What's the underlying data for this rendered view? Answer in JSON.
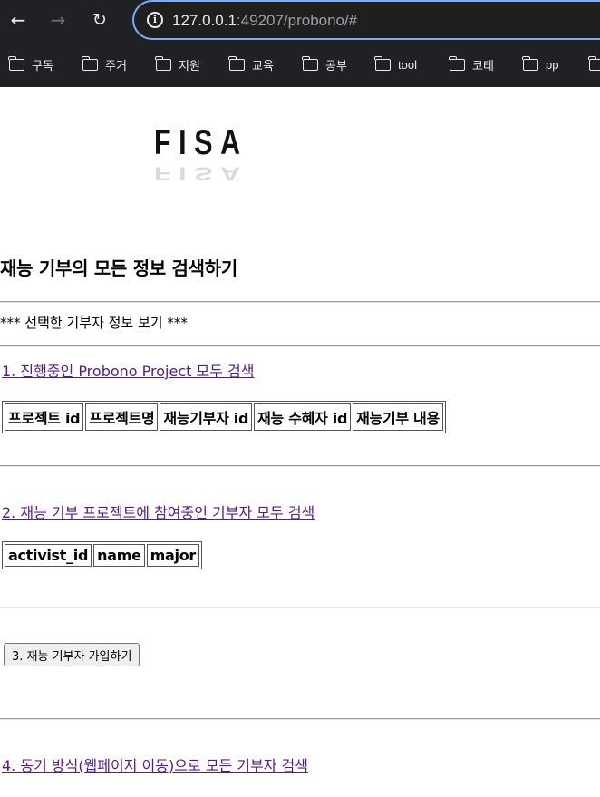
{
  "browser": {
    "url_host": "127.0.0.1",
    "url_rest": ":49207/probono/#",
    "bookmarks": [
      "구독",
      "주거",
      "지원",
      "교육",
      "공부",
      "tool",
      "코테",
      "pp"
    ]
  },
  "logo": {
    "text": "FISA"
  },
  "page": {
    "title": "재능 기부의 모든 정보 검색하기",
    "subtitle": "*** 선택한 기부자 정보 보기 ***"
  },
  "section1": {
    "link": "1. 진행중인 Probono Project 모두 검색",
    "columns": [
      "프로젝트 id",
      "프로젝트명",
      "재능기부자 id",
      "재능 수혜자 id",
      "재능기부 내용"
    ]
  },
  "section2": {
    "link": "2. 재능 기부 프로젝트에 참여중인 기부자 모두 검색",
    "columns": [
      "activist_id",
      "name",
      "major"
    ]
  },
  "section3": {
    "button": "3. 재능 기부자 가입하기"
  },
  "section4": {
    "link": "4. 동기 방식(웹페이지 이동)으로 모든 기부자 검색"
  }
}
